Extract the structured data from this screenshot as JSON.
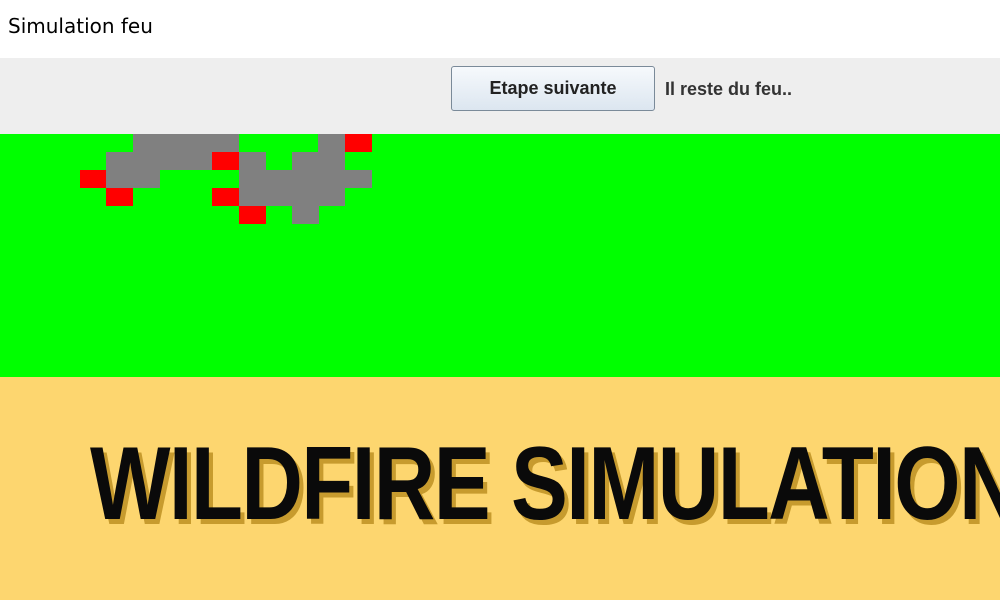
{
  "window": {
    "title": "Simulation feu"
  },
  "toolbar": {
    "next_step_label": "Etape suivante",
    "status_text": "Il reste du feu.."
  },
  "banner": {
    "title": "WILDFIRE SIMULATION"
  },
  "simulation_grid": {
    "colors": {
      "forest": "#00ff00",
      "ash": "#808080",
      "fire": "#ff0000"
    },
    "cells": [
      {
        "col": 5,
        "row": 0,
        "state": "ash"
      },
      {
        "col": 6,
        "row": 0,
        "state": "ash"
      },
      {
        "col": 7,
        "row": 0,
        "state": "ash"
      },
      {
        "col": 8,
        "row": 0,
        "state": "ash"
      },
      {
        "col": 12,
        "row": 0,
        "state": "ash"
      },
      {
        "col": 13,
        "row": 0,
        "state": "fire"
      },
      {
        "col": 4,
        "row": 1,
        "state": "ash"
      },
      {
        "col": 5,
        "row": 1,
        "state": "ash"
      },
      {
        "col": 6,
        "row": 1,
        "state": "ash"
      },
      {
        "col": 7,
        "row": 1,
        "state": "ash"
      },
      {
        "col": 8,
        "row": 1,
        "state": "fire"
      },
      {
        "col": 9,
        "row": 1,
        "state": "ash"
      },
      {
        "col": 11,
        "row": 1,
        "state": "ash"
      },
      {
        "col": 12,
        "row": 1,
        "state": "ash"
      },
      {
        "col": 3,
        "row": 2,
        "state": "fire"
      },
      {
        "col": 4,
        "row": 2,
        "state": "ash"
      },
      {
        "col": 5,
        "row": 2,
        "state": "ash"
      },
      {
        "col": 9,
        "row": 2,
        "state": "ash"
      },
      {
        "col": 10,
        "row": 2,
        "state": "ash"
      },
      {
        "col": 11,
        "row": 2,
        "state": "ash"
      },
      {
        "col": 12,
        "row": 2,
        "state": "ash"
      },
      {
        "col": 13,
        "row": 2,
        "state": "ash"
      },
      {
        "col": 4,
        "row": 3,
        "state": "fire"
      },
      {
        "col": 8,
        "row": 3,
        "state": "fire"
      },
      {
        "col": 9,
        "row": 3,
        "state": "ash"
      },
      {
        "col": 10,
        "row": 3,
        "state": "ash"
      },
      {
        "col": 11,
        "row": 3,
        "state": "ash"
      },
      {
        "col": 12,
        "row": 3,
        "state": "ash"
      },
      {
        "col": 9,
        "row": 4,
        "state": "fire"
      },
      {
        "col": 11,
        "row": 4,
        "state": "ash"
      }
    ]
  }
}
